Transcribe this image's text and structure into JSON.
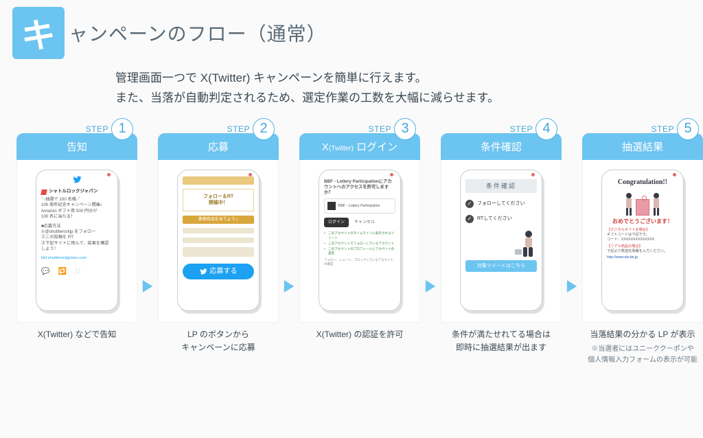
{
  "title": {
    "badge": "キ",
    "rest": "ャンペーンのフロー（通常）"
  },
  "lead1": "管理画面一つで X(Twitter) キャンペーンを簡単に行えます。",
  "lead2": "また、当落が自動判定されるため、選定作業の工数を大幅に減らせます。",
  "step_word": "STEP",
  "steps": [
    {
      "num": "1",
      "title": "告知",
      "caption": "X(Twitter) などで告知",
      "tweet": {
        "name": "シャトルロックジャパン",
        "body1": "＼抽選で 100 名様／",
        "body2": "100 周年記念キャンペーン開催♪",
        "body3": "Amazon ギフト券 500 円分が",
        "body4": "100 名に当たる！",
        "howto_h": "■応募方法",
        "howto1": "①@shuttlerockjp をフォロー",
        "howto2": "②この投稿を RT",
        "howto3": "③下記サイトに飛んで、結果を確認しよう！",
        "link": "bbf.shuttlerockjp/ooo.com"
      }
    },
    {
      "num": "2",
      "title": "応募",
      "caption": "LP のボタンから\nキャンペーンに応募",
      "lp": {
        "head1": "フォロー＆RT",
        "head2": "開催中！",
        "banner": "豪華商品を当てよう♫",
        "apply": "応募する"
      }
    },
    {
      "num": "3",
      "title_pre": "X",
      "title_small": "(Twitter)",
      "title_post": " ログイン",
      "caption": "X(Twitter) の認証を許可",
      "auth": {
        "q": "BBF - Lottery Participationにアカウントへのアクセスを許可しますか？",
        "app": "BBF - Lottery Participation",
        "login": "ログイン",
        "cancel": "キャンセル",
        "perm1": "このアカウントのタイムラインに表示されるツイート",
        "perm2": "このアカウントでフォローしているアカウント",
        "perm3": "このアカウントのプロフィールとアカウントの設定",
        "note": "フォロー、ミュート、ブロックしているアカウントの確認"
      }
    },
    {
      "num": "4",
      "title": "条件確認",
      "caption": "条件が満たせれてる場合は\n即時に抽選結果が出ます",
      "cond": {
        "head": "条件確認",
        "c1": "フォローしてください",
        "c2": "RTしてください",
        "cta": "対象ツイートはこちら"
      }
    },
    {
      "num": "5",
      "title": "抽選結果",
      "caption": "当落結果の分かる LP が表示",
      "note": "※当選者にはユニーククーポンや\n個人情報入力フォームの表示が可能",
      "result": {
        "congrats": "Congratulation!!",
        "omede": "おめでとうございます！",
        "dig_h": "【デジタルギフトの場合】",
        "dig1": "ギフトコードは下記です。",
        "dig2": "コード：XXXXXXXXXXXXXX",
        "real_h": "【リアル商品の場合】",
        "real1": "下記より発送先情報を入力ください。",
        "link": "http://www.abcde.jp"
      }
    }
  ]
}
